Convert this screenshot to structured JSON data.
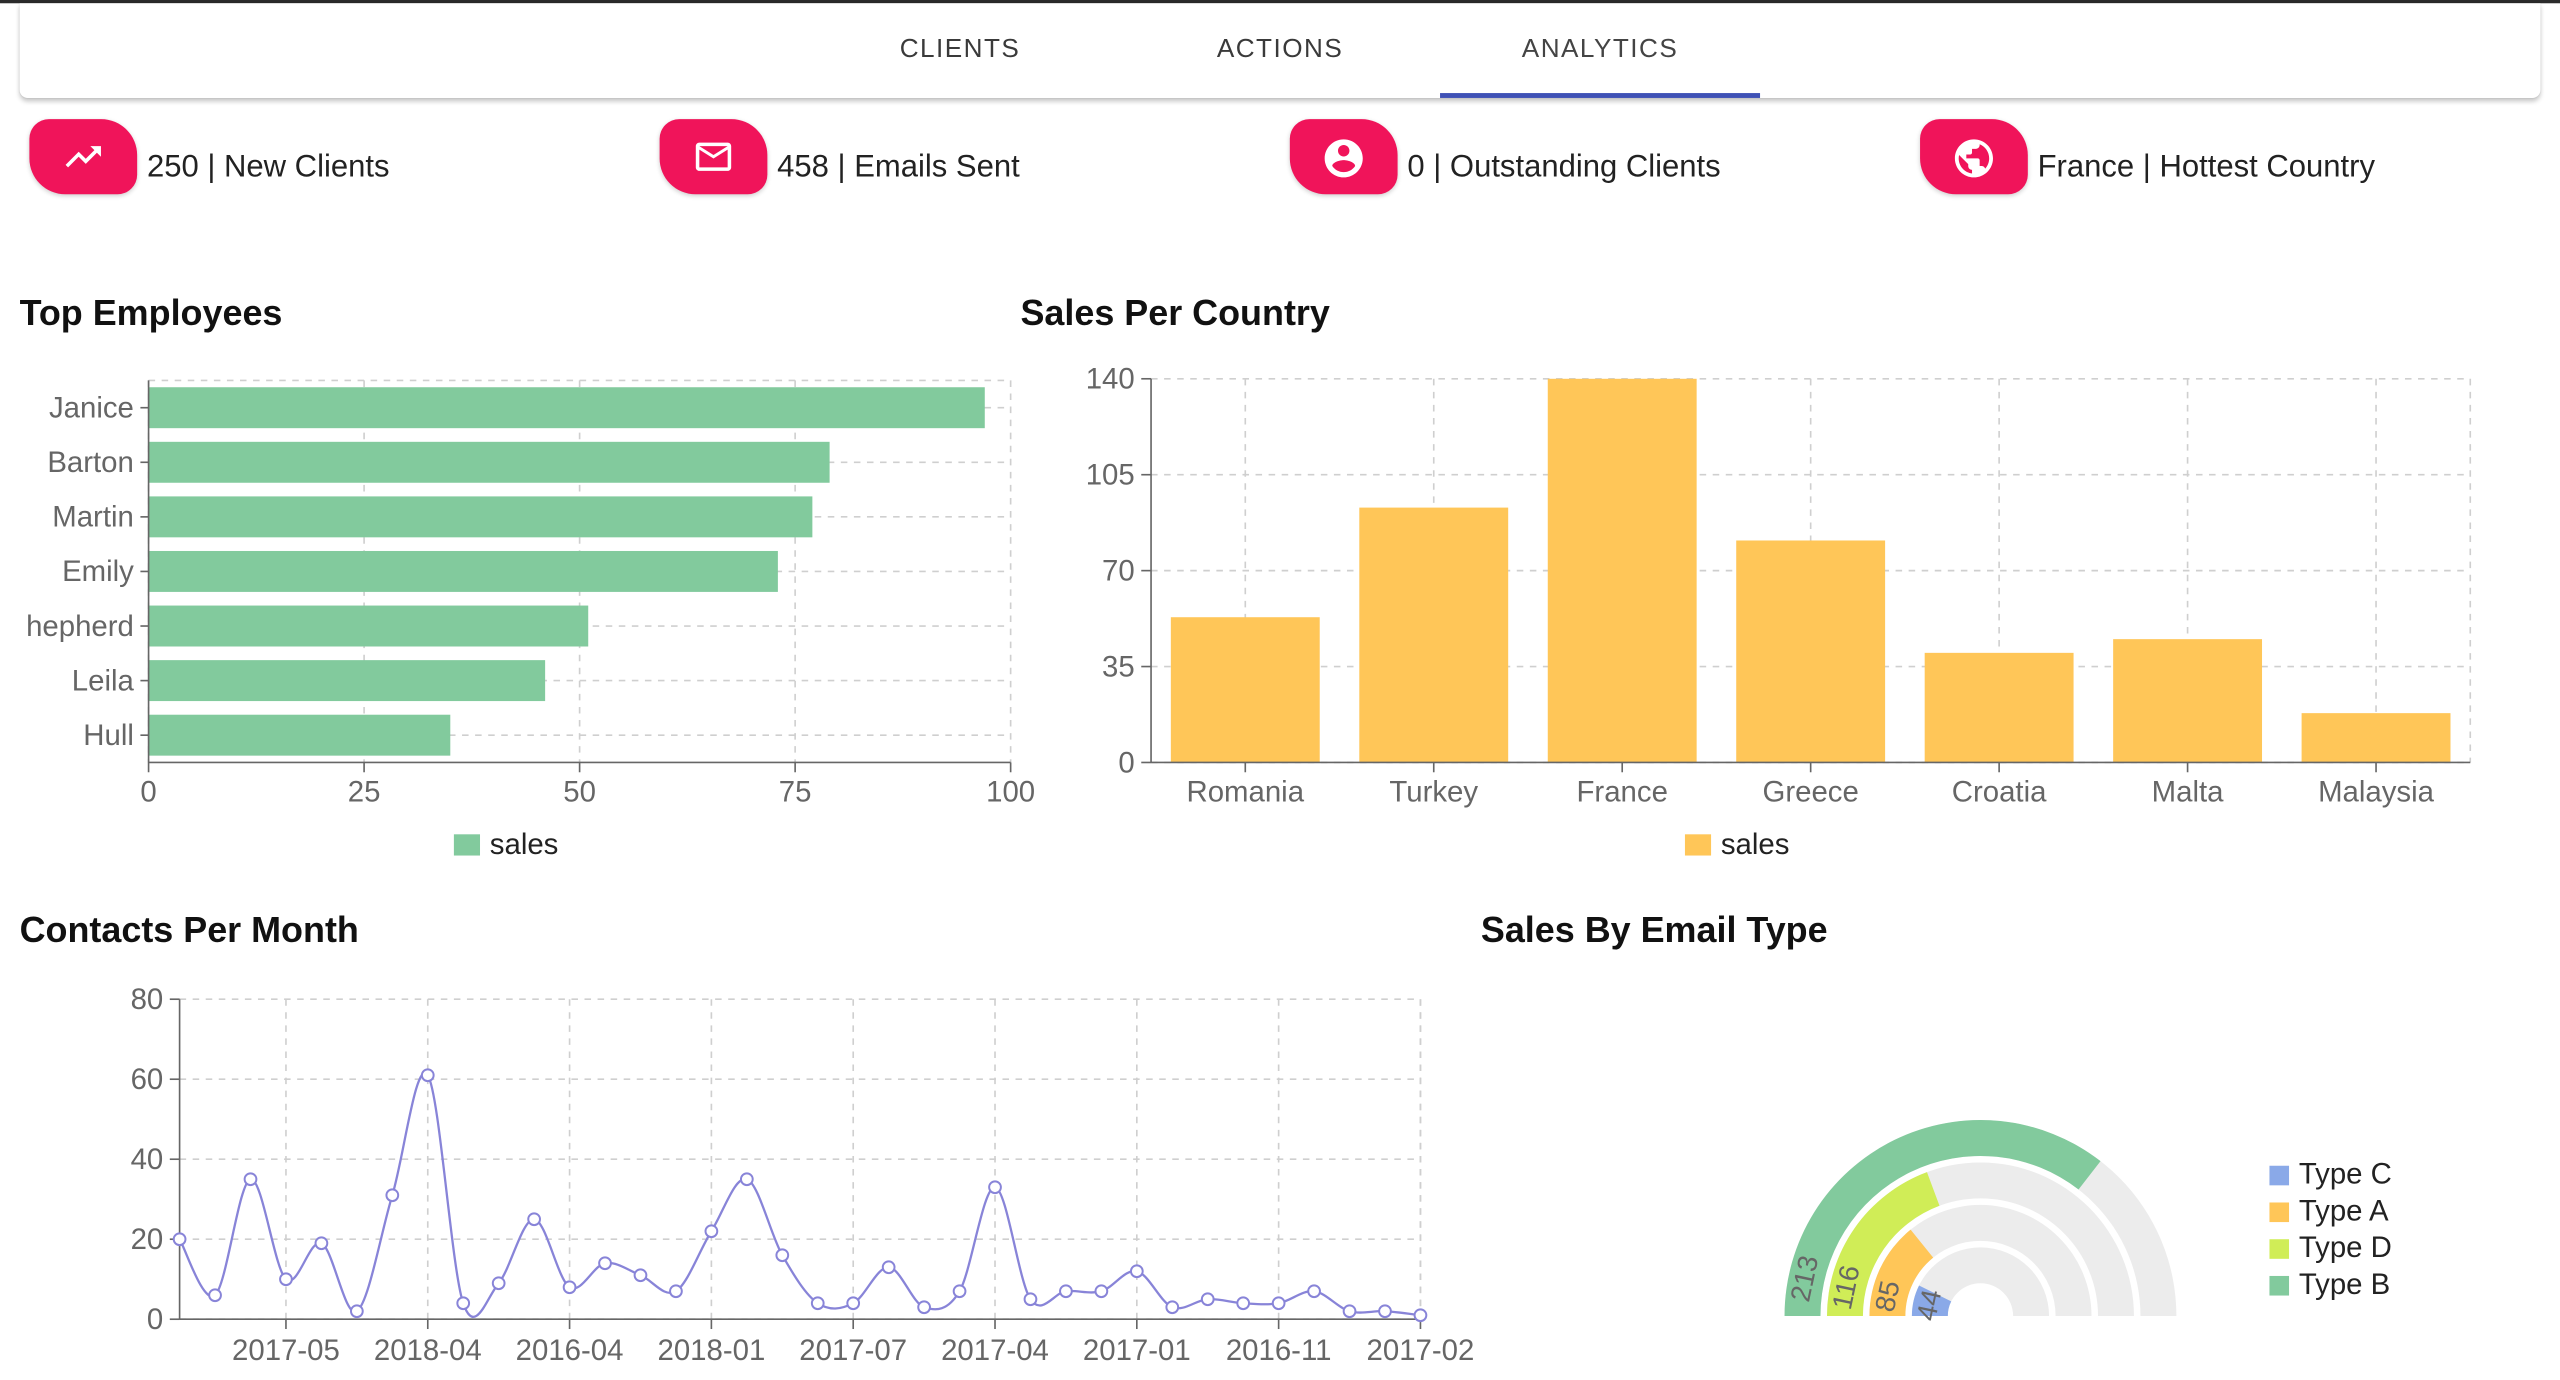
{
  "nav": {
    "tabs": [
      {
        "label": "CLIENTS"
      },
      {
        "label": "ACTIONS"
      },
      {
        "label": "ANALYTICS",
        "active": true
      }
    ],
    "accent_color": "#3f51b5"
  },
  "stats": [
    {
      "icon": "trending-up-icon",
      "text": "250 | New Clients"
    },
    {
      "icon": "mail-icon",
      "text": "458 | Emails Sent"
    },
    {
      "icon": "account-circle-icon",
      "text": "0 | Outstanding Clients"
    },
    {
      "icon": "globe-icon",
      "text": "France | Hottest Country"
    }
  ],
  "badge_color": "#f0145a",
  "sections": {
    "top_employees": "Top Employees",
    "sales_per_country": "Sales Per Country",
    "contacts_per_month": "Contacts Per Month",
    "sales_by_email_type": "Sales By Email Type"
  },
  "chart_data": [
    {
      "type": "bar",
      "orientation": "horizontal",
      "title": "Top Employees",
      "categories": [
        "Janice",
        "Barton",
        "Martin",
        "Emily",
        "hepherd",
        "Leila",
        "Hull"
      ],
      "series": [
        {
          "name": "sales",
          "values": [
            97,
            79,
            77,
            73,
            51,
            46,
            35
          ],
          "color": "#82ca9d"
        }
      ],
      "xticks": [
        0,
        25,
        50,
        75,
        100
      ],
      "xlim": [
        0,
        100
      ],
      "grid": true,
      "legend": "bottom"
    },
    {
      "type": "bar",
      "title": "Sales Per Country",
      "categories": [
        "Romania",
        "Turkey",
        "France",
        "Greece",
        "Croatia",
        "Malta",
        "Malaysia"
      ],
      "series": [
        {
          "name": "sales",
          "values": [
            53,
            93,
            140,
            81,
            40,
            45,
            18
          ],
          "color": "#ffc658"
        }
      ],
      "yticks": [
        0,
        35,
        70,
        105,
        140
      ],
      "ylim": [
        0,
        140
      ],
      "grid": true,
      "legend": "bottom"
    },
    {
      "type": "line",
      "title": "Contacts Per Month",
      "x_tick_labels": [
        "2017-05",
        "2018-04",
        "2016-04",
        "2018-01",
        "2017-07",
        "2017-04",
        "2017-01",
        "2016-11",
        "2017-02"
      ],
      "values": [
        20,
        6,
        35,
        10,
        19,
        2,
        31,
        61,
        4,
        9,
        25,
        8,
        14,
        11,
        7,
        22,
        35,
        16,
        4,
        4,
        13,
        3,
        7,
        33,
        5,
        7,
        7,
        12,
        3,
        5,
        4,
        4,
        7,
        2,
        2,
        1
      ],
      "yticks": [
        0,
        20,
        40,
        60,
        80
      ],
      "ylim": [
        0,
        80
      ],
      "color": "#8884d8",
      "grid": true
    },
    {
      "type": "radial_bar",
      "title": "Sales By Email Type",
      "max": 300,
      "series": [
        {
          "name": "Type C",
          "value": 44,
          "color": "#8aa9e8"
        },
        {
          "name": "Type A",
          "value": 85,
          "color": "#ffc658"
        },
        {
          "name": "Type D",
          "value": 116,
          "color": "#d0ed57"
        },
        {
          "name": "Type B",
          "value": 213,
          "color": "#82ca9d"
        }
      ],
      "legend": "right"
    }
  ]
}
